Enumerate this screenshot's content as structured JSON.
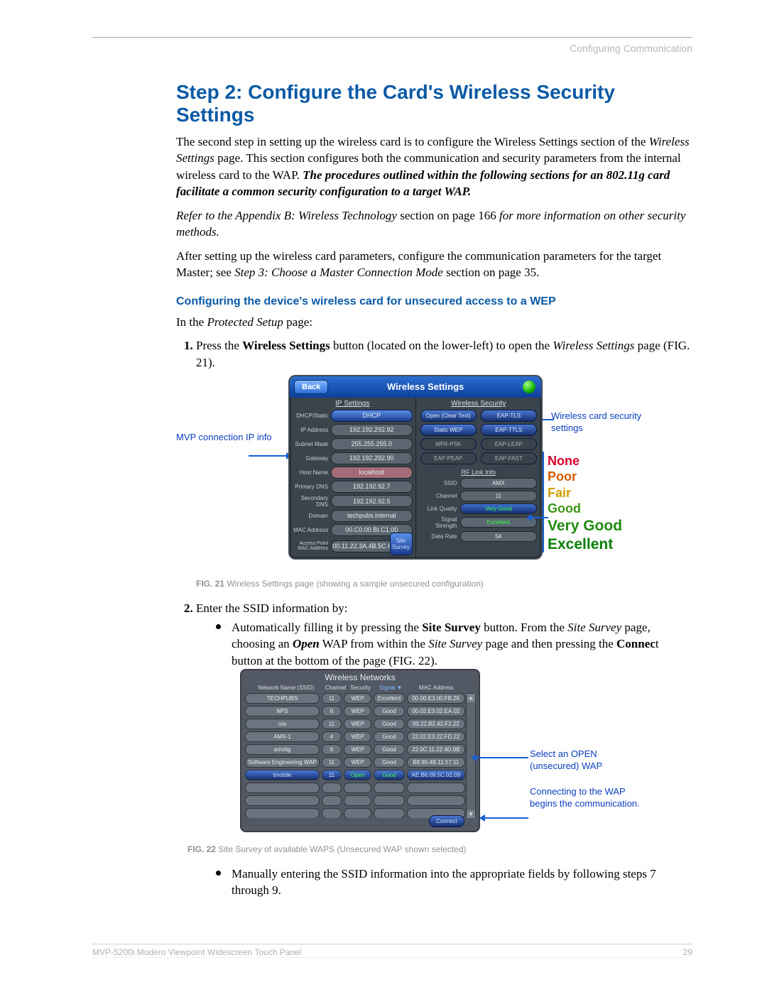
{
  "header": {
    "section": "Configuring Communication"
  },
  "h1": "Step 2: Configure the Card's Wireless Security Settings",
  "p1a": "The second step in setting up the wireless card is to configure the Wireless Settings section of the ",
  "p1b": "Wireless Settings",
  "p1c": " page. This section configures both the communication and security parameters from the internal wireless card to the WAP. ",
  "p1d": "The procedures outlined within the following sections for an 802.11g card facilitate a common security configuration to a target WAP.",
  "p2a": "Refer to the Appendix B: Wireless Technology ",
  "p2b": "section on page 166 ",
  "p2c": "for more information on other security methods.",
  "p3a": "After setting up the wireless card parameters, configure the communication parameters for the target Master; see ",
  "p3b": "Step 3: Choose a Master Connection Mode",
  "p3c": " section on page 35.",
  "h2": "Configuring the device's wireless card for unsecured access to a WEP",
  "p4a": "In the ",
  "p4b": "Protected Setup",
  "p4c": " page:",
  "li1a": "Press the ",
  "li1b": "Wireless Settings",
  "li1c": " button (located on the lower-left) to open the ",
  "li1d": "Wireless Settings",
  "li1e": " page (FIG. 21).",
  "callouts": {
    "mvp": "MVP connection IP info",
    "sec": "Wireless card security settings",
    "open": "Select an OPEN (unsecured) WAP",
    "conn": "Connecting to the WAP begins the communication."
  },
  "panel": {
    "back": "Back",
    "title": "Wireless Settings",
    "colL": "IP Settings",
    "colR": "Wireless Security",
    "site": "Site Survey",
    "ip": {
      "dhcpLbl": "DHCP/Static",
      "dhcp": "DHCP",
      "ipLbl": "IP Address",
      "ip": "192.192.292.92",
      "smLbl": "Subnet Mask",
      "sm": "255.255.255.0",
      "gwLbl": "Gateway",
      "gw": "192.192.292.90",
      "hnLbl": "Host Name",
      "hn": "localhost",
      "pdLbl": "Primary DNS",
      "pd": "192.192.92.7",
      "sdLbl": "Secondary DNS",
      "sd": "192.192.92.5",
      "domLbl": "Domain",
      "dom": "techpubs.internal",
      "macLbl": "MAC Address",
      "mac": "00.C0.00.BI.C1.00",
      "apLbl": "Access Point MAC Address",
      "ap": "00.11.22.3A.4B.5C.6D"
    },
    "sec": {
      "s1": "Open (Clear Text)",
      "s2": "EAP-TLS",
      "s3": "Static WEP",
      "s4": "EAP-TTLS",
      "s5": "WPA-PSK",
      "s6": "EAP-LEAP",
      "s7": "EAP-PEAP",
      "s8": "EAP-FAST"
    },
    "rf": {
      "hdr": "RF Link Info",
      "ssidL": "SSID",
      "ssid": "AMX",
      "chL": "Channel",
      "ch": "11",
      "lqL": "Link Quality",
      "lq": "Very Good",
      "ssL": "Signal Strength",
      "ss": "Excellent",
      "drL": "Data Rate",
      "dr": "54"
    }
  },
  "qscale": {
    "none": "None",
    "poor": "Poor",
    "fair": "Fair",
    "good": "Good",
    "vg": "Very Good",
    "ex": "Excellent"
  },
  "figcap21a": "FIG. 21",
  "figcap21b": "  Wireless Settings page (showing a sample unsecured configuration)",
  "li2": "Enter the SSID information by:",
  "b1a": "Automatically filling it by pressing the ",
  "b1b": "Site Survey",
  "b1c": " button. From the ",
  "b1d": "Site Survey",
  "b1e": " page, choosing an ",
  "b1f": "Open",
  "b1g": " WAP from within the ",
  "b1h": "Site Survey",
  "b1i": " page and then pressing the ",
  "b1j": "Connec",
  "b1k": "t button at the bottom of the page (FIG. 22).",
  "net": {
    "title": "Wireless Networks",
    "hdr": {
      "name": "Network Name (SSID)",
      "ch": "Channel",
      "sec": "Security",
      "sig": "Signal ▼",
      "mac": "MAC Address"
    },
    "rows": [
      {
        "name": "TECHPUBS",
        "ch": "11",
        "sec": "WEP",
        "sig": "Excellent",
        "mac": "00.00.E3.00.FB.26"
      },
      {
        "name": "NPS",
        "ch": "6",
        "sec": "WEP",
        "sig": "Good",
        "mac": "00.02.E3.02.EA.02"
      },
      {
        "name": "n/a",
        "ch": "11",
        "sec": "WEP",
        "sig": "Good",
        "mac": "00.22.B2.42.F2.22"
      },
      {
        "name": "AMX-1",
        "ch": "4",
        "sec": "WEP",
        "sig": "Good",
        "mac": "22.02.E3.22.FD.22"
      },
      {
        "name": "amxitg",
        "ch": "6",
        "sec": "WEP",
        "sig": "Good",
        "mac": "22.0C.11.22.4D.9B"
      },
      {
        "name": "Software Engineering WAP",
        "ch": "11",
        "sec": "WEP",
        "sig": "Good",
        "mac": "B8.90.4B.11.57.11"
      },
      {
        "name": "tmobile",
        "ch": "11",
        "sec": "Open",
        "sig": "Good",
        "mac": "AE.B6.09.5C.02.09",
        "sel": true
      }
    ],
    "connect": "Connect"
  },
  "figcap22a": "FIG. 22",
  "figcap22b": "  Site Survey of available WAPS (Unsecured WAP shown selected)",
  "b2": "Manually entering the SSID information into the appropriate fields by following steps 7 through 9.",
  "footer": {
    "left": "MVP-5200i Modero Viewpoint Widescreen Touch Panel",
    "right": "29"
  }
}
